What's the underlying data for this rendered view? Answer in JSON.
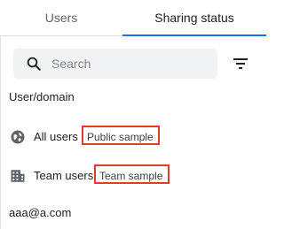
{
  "tabs": [
    {
      "label": "Users",
      "active": false
    },
    {
      "label": "Sharing status",
      "active": true
    }
  ],
  "accent_color": "#1a73e8",
  "highlight_color": "#e53b2c",
  "search": {
    "placeholder": "Search",
    "value": ""
  },
  "table": {
    "column_header": "User/domain",
    "rows": [
      {
        "icon": "globe-icon",
        "label": "All users",
        "status": "Public sample"
      },
      {
        "icon": "building-icon",
        "label": "Team users",
        "status": "Team sample"
      },
      {
        "label": "aaa@a.com"
      }
    ]
  }
}
